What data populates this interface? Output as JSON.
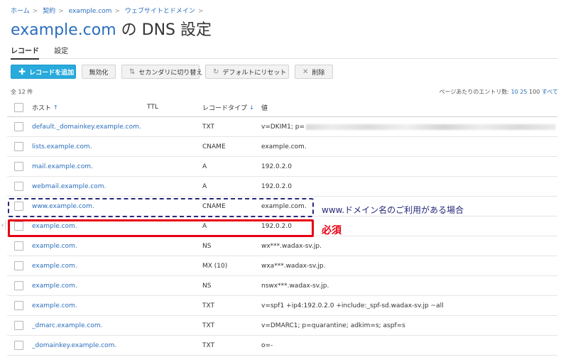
{
  "breadcrumb": [
    "ホーム",
    "契約",
    "example.com",
    "ウェブサイトとドメイン"
  ],
  "title": {
    "domain": "example.com",
    "rest": " の DNS 設定"
  },
  "tabs": [
    {
      "label": "レコード",
      "active": true
    },
    {
      "label": "設定",
      "active": false
    }
  ],
  "toolbar": {
    "add": "レコードを追加",
    "disable": "無効化",
    "secondary": "セカンダリに切り替え",
    "reset": "デフォルトにリセット",
    "delete": "削除"
  },
  "list": {
    "total": "全 12 件",
    "perpage_label": "ページあたりのエントリ数:",
    "perpage_options": [
      "10",
      "25",
      "100",
      "すべて"
    ]
  },
  "columns": {
    "host": "ホスト",
    "ttl": "TTL",
    "type": "レコードタイプ",
    "value": "値",
    "host_sort": "↑",
    "type_sort": "↓"
  },
  "rows": [
    {
      "host": "default._domainkey.example.com.",
      "type": "TXT",
      "value": "v=DKIM1; p="
    },
    {
      "host": "lists.example.com.",
      "type": "CNAME",
      "value": "example.com."
    },
    {
      "host": "mail.example.com.",
      "type": "A",
      "value": "192.0.2.0"
    },
    {
      "host": "webmail.example.com.",
      "type": "A",
      "value": "192.0.2.0"
    },
    {
      "host": "www.example.com.",
      "type": "CNAME",
      "value": "example.com."
    },
    {
      "host": "example.com.",
      "type": "A",
      "value": "192.0.2.0"
    },
    {
      "host": "example.com.",
      "type": "NS",
      "value": "wx***.wadax-sv.jp."
    },
    {
      "host": "example.com.",
      "type": "MX (10)",
      "value": "wxa***.wadax-sv.jp."
    },
    {
      "host": "example.com.",
      "type": "NS",
      "value": "nswx***.wadax-sv.jp."
    },
    {
      "host": "example.com.",
      "type": "TXT",
      "value": "v=spf1 +ip4:192.0.2.0 +include:_spf-sd.wadax-sv.jp ~all"
    },
    {
      "host": "_dmarc.example.com.",
      "type": "TXT",
      "value": "v=DMARC1; p=quarantine; adkim=s; aspf=s"
    },
    {
      "host": "_domainkey.example.com.",
      "type": "TXT",
      "value": "o=-"
    }
  ],
  "annotations": {
    "www": "www.ドメイン名のご利用がある場合",
    "required": "必須"
  },
  "colors": {
    "link": "#2a6ebd",
    "primary_button": "#28aadc",
    "required_red": "#e60012",
    "dashed_navy": "#27297b"
  },
  "icons": {
    "add": "plus-icon",
    "secondary": "swap-icon",
    "reset": "reset-icon",
    "delete": "delete-icon"
  }
}
